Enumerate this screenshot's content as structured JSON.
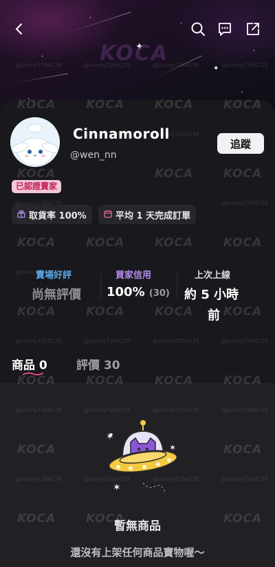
{
  "watermark": {
    "logo": "KOCA",
    "user": "@sunny7264239"
  },
  "profile": {
    "name": "Cinnamoroll",
    "handle": "@wen_nn",
    "follow_label": "追蹤",
    "certified_label": "已認證賣家"
  },
  "badges": [
    {
      "icon": "gift-icon",
      "text": "取貨率 100%"
    },
    {
      "icon": "calendar-icon",
      "text": "平均 1 天完成訂單"
    }
  ],
  "stats": {
    "rating_label": "賣場好評",
    "rating_value": "尚無評價",
    "credit_label": "買家信用",
    "credit_value": "100%",
    "credit_count": "(30)",
    "online_label": "上次上線",
    "online_value_line1": "約 5 小時",
    "online_value_line2": "前"
  },
  "colors": {
    "rating_label": "#5aa7e6",
    "credit_label": "#b78cf0",
    "online_label": "#d9d9de",
    "accent_pink": "#e04c7c"
  },
  "tabs": [
    {
      "label": "商品",
      "count": "0",
      "active": true
    },
    {
      "label": "評價",
      "count": "30",
      "active": false
    }
  ],
  "empty_state": {
    "title": "暫無商品",
    "subtitle": "還沒有上架任何商品寶物喔～"
  },
  "icons": {
    "back": "back-arrow-icon",
    "search": "search-icon",
    "chat": "chat-icon",
    "share": "share-icon"
  }
}
